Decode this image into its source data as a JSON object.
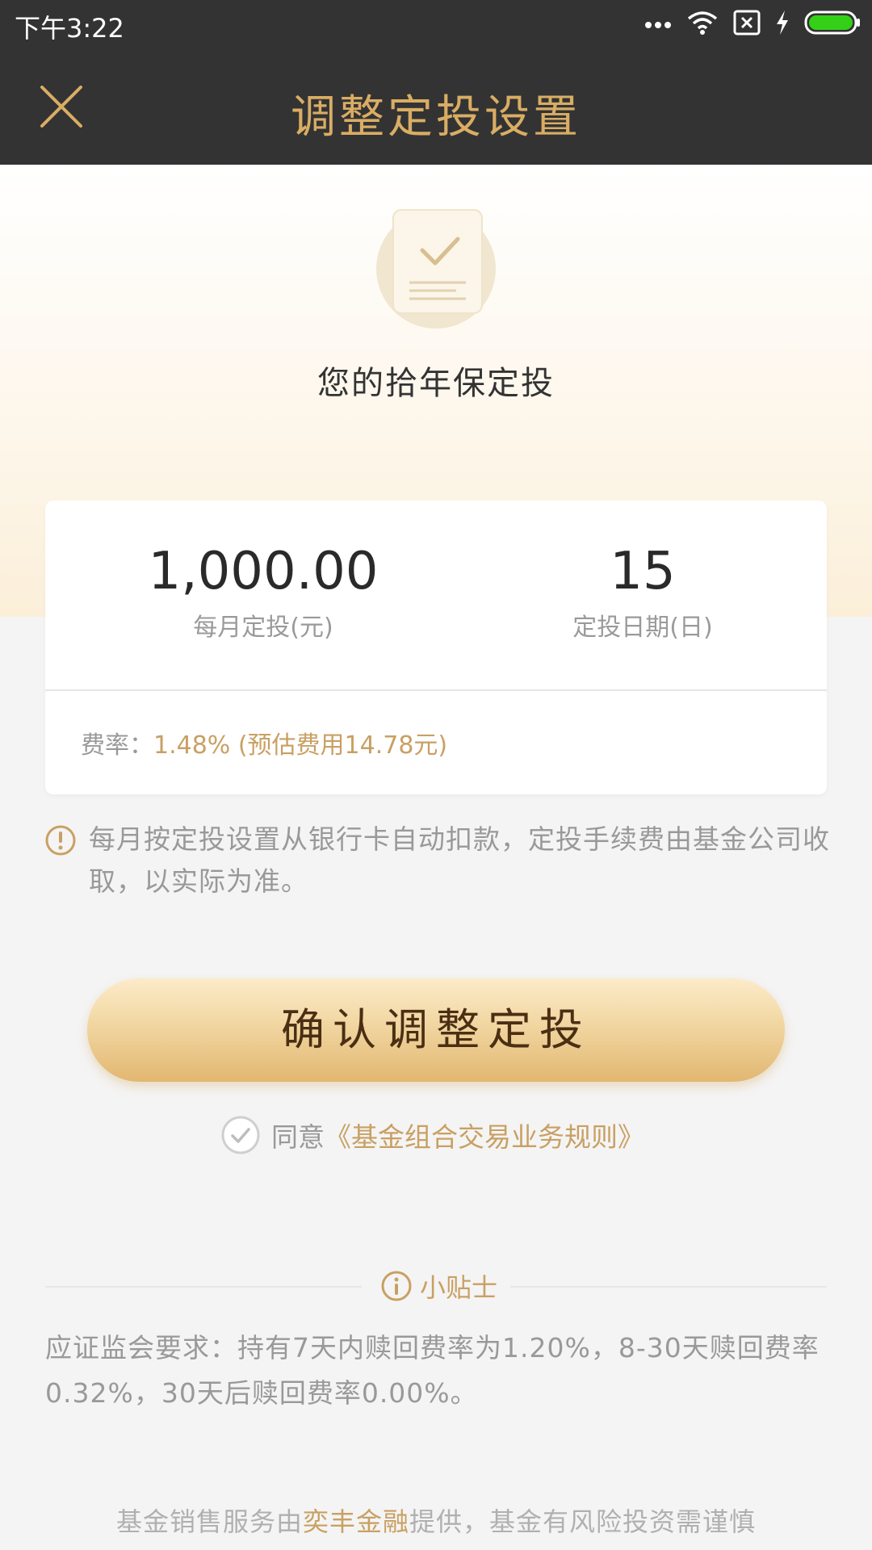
{
  "status_bar": {
    "time": "下午3:22"
  },
  "header": {
    "title": "调整定投设置"
  },
  "hero": {
    "plan_name": "您的拾年保定投"
  },
  "summary": {
    "monthly_amount": "1,000.00",
    "monthly_amount_label": "每月定投(元)",
    "day": "15",
    "day_label": "定投日期(日)",
    "fee_label": "费率：",
    "fee_value": "1.48% (预估费用14.78元)"
  },
  "notice": {
    "text": "每月按定投设置从银行卡自动扣款，定投手续费由基金公司收取，以实际为准。"
  },
  "confirm_button": {
    "label": "确认调整定投"
  },
  "agreement": {
    "prefix": "同意",
    "link": "《基金组合交易业务规则》",
    "checked": true
  },
  "tips": {
    "title": "小贴士",
    "body": "应证监会要求：持有7天内赎回费率为1.20%，8-30天赎回费率0.32%，30天后赎回费率0.00%。"
  },
  "footer": {
    "prefix": "基金销售服务由",
    "brand": "奕丰金融",
    "suffix": "提供，基金有风险投资需谨慎"
  },
  "colors": {
    "gold": "#d9ad63",
    "header_bg": "#333334",
    "link": "#c9a063"
  },
  "icons": [
    "more-dots-icon",
    "wifi-icon",
    "sim-icon",
    "charging-icon",
    "battery-icon",
    "close-icon",
    "document-check-icon",
    "info-icon",
    "check-circle-icon"
  ]
}
